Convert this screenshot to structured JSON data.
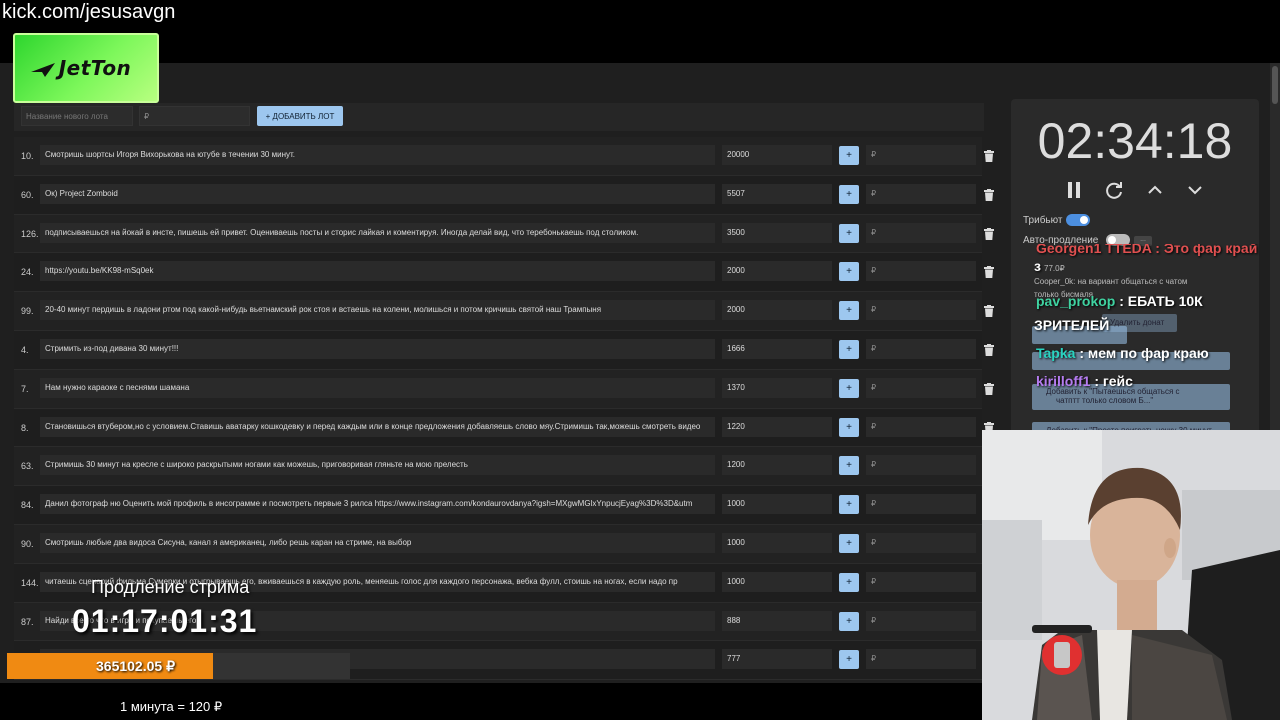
{
  "stream_url": "kick.com/jesusavgn",
  "logo_text": "JetTon",
  "new_lot": {
    "name_placeholder": "Название нового лота",
    "price_placeholder": "₽",
    "add_button": "+ ДОБАВИТЬ ЛОТ"
  },
  "lots": [
    {
      "num": "10.",
      "name": "Смотришь шортсы Игоря Вихорькова на ютубе в течении 30 минут.",
      "amount": "20000",
      "rub": "₽"
    },
    {
      "num": "60.",
      "name": "Ок) Project Zomboid",
      "amount": "5507",
      "rub": "₽"
    },
    {
      "num": "126.",
      "name": "подписываешься на йокай в инсте, пишешь ей привет. Оцениваешь посты и сторис лайкая и коментируя. Иногда делай вид, что теребонькаешь под столиком.",
      "amount": "3500",
      "rub": "₽"
    },
    {
      "num": "24.",
      "name": "https://youtu.be/KK98-mSq0ek",
      "amount": "2000",
      "rub": "₽"
    },
    {
      "num": "99.",
      "name": "20-40 минут пердишь в ладони ртом под какой-нибудь вьетнамский рок стоя и встаешь на колени, молишься и потом кричишь святой наш Трампыня",
      "amount": "2000",
      "rub": "₽"
    },
    {
      "num": "4.",
      "name": "Стримить из-под дивана 30 минут!!!",
      "amount": "1666",
      "rub": "₽"
    },
    {
      "num": "7.",
      "name": "Нам нужно караоке с песнями шамана",
      "amount": "1370",
      "rub": "₽"
    },
    {
      "num": "8.",
      "name": "Становишься втубером,но с условием.Ставишь аватарку кошкодевку и перед каждым или в конце предложения добавляешь слово мяу.Стримишь так,можешь смотреть видео",
      "amount": "1220",
      "rub": "₽"
    },
    {
      "num": "63.",
      "name": "Стримишь 30 минут на кресле с широко раскрытыми ногами как можешь, приговоривая гляньте на мою прелесть",
      "amount": "1200",
      "rub": "₽"
    },
    {
      "num": "84.",
      "name": "Данил фотограф ню Оценить мой профиль в инсограмме и посмотреть первые 3 рилса https://www.instagram.com/kondaurovdanya?igsh=MXgwMGlxYnpucjEyag%3D%3D&utm",
      "amount": "1000",
      "rub": "₽"
    },
    {
      "num": "90.",
      "name": "Смотришь любые два видоса Сисуна, канал я американец, либо решь каран на стриме, на выбор",
      "amount": "1000",
      "rub": "₽"
    },
    {
      "num": "144.",
      "name": "читаешь сценарий фильма Сумерки и отыгрываешь его, вживаешься в каждую роль, меняешь голос для каждого персонажа, вебка фулл, стоишь на ногах, если надо пр",
      "amount": "1000",
      "rub": "₽"
    },
    {
      "num": "87.",
      "name": "Найди все то что в игре и покупаешь его",
      "amount": "888",
      "rub": "₽"
    },
    {
      "num": "",
      "name": "",
      "amount": "777",
      "rub": "₽"
    }
  ],
  "timer": {
    "value": "02:34:18"
  },
  "toggles": {
    "tribute_label": "Трибьют",
    "tribute_on": true,
    "auto_extend_label": "Авто-продление",
    "auto_extend_on": false,
    "more_label": "..."
  },
  "chat": {
    "top_fragment": "Georgen1 TTEDA : Это фар край",
    "line0_tail": "з",
    "faint_amount": "77.0₽",
    "faint_user_line": "Cooper_0k: на вариант общаться с чатом",
    "faint_user_line2": "только бисмаля",
    "msg1_user": "pav_prokop",
    "msg1_text": ": ЕБАТЬ 10К",
    "msg1_text2": "ЗРИТЕЛЕЙ",
    "faint_delete": "Удалить донат",
    "msg2_user": "Tapka",
    "msg2_text": ": мем по фар краю",
    "faint_add_line": "Добавить к \"Пытаешься общаться с",
    "faint_add_line2": "чатптт только словом Б...\"",
    "msg3_user": "kirilloff1",
    "msg3_text": ": гейс",
    "faint_bottom": "Добавить к \"Просто поиграть ночку 30 минут"
  },
  "extension": {
    "title": "Продление стрима",
    "time": "01:17:01:31"
  },
  "progress": {
    "value_text": "365102.05 ₽",
    "fill_fraction": 0.6
  },
  "rate_text": "1 минута = 120 ₽",
  "colors": {
    "accent_blue": "#9dc7ef",
    "progress_orange": "#f08a12",
    "logo_green": "#2ed62e",
    "user_green": "#3fd3a1",
    "user_teal": "#2ad3c0",
    "user_purple": "#b57cf0",
    "user_red": "#e05050"
  }
}
